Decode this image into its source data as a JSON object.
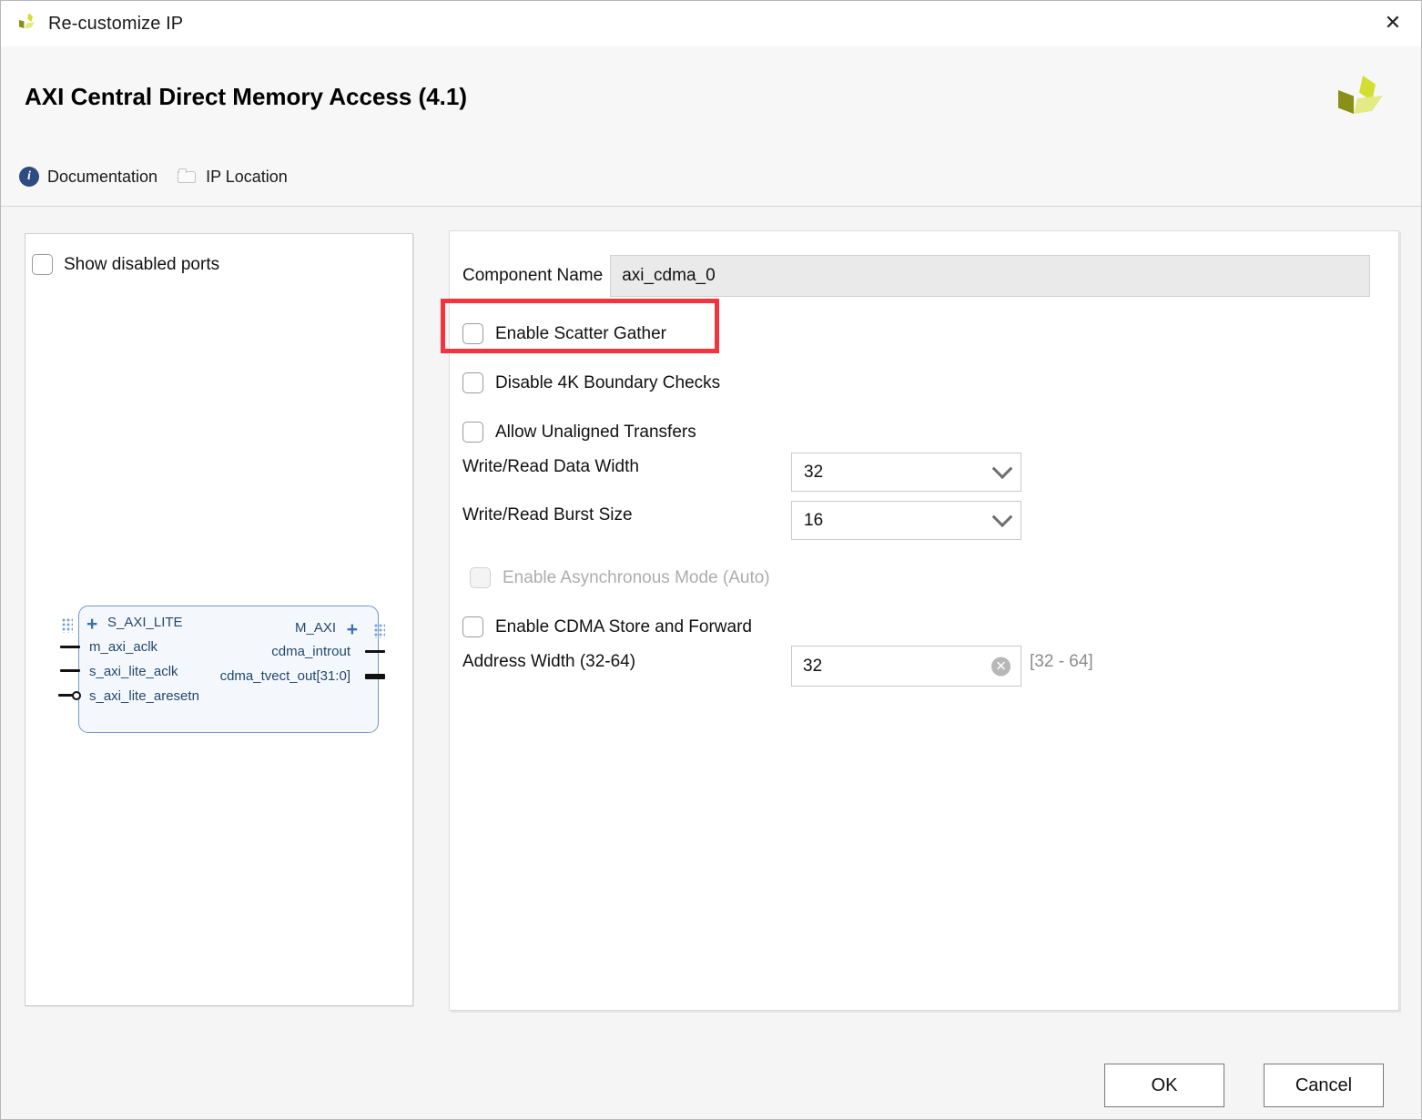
{
  "window": {
    "title": "Re-customize IP",
    "close_label": "✕",
    "logo_name": "xilinx-logo"
  },
  "header": {
    "ip_title": "AXI Central Direct Memory Access (4.1)",
    "links": [
      {
        "label": "Documentation",
        "icon": "info-icon"
      },
      {
        "label": "IP Location",
        "icon": "folder-icon"
      }
    ]
  },
  "ports_panel": {
    "show_disabled_ports_label": "Show disabled ports",
    "show_disabled_ports_checked": false,
    "diagram": {
      "left_ports": [
        {
          "name": "S_AXI_LITE",
          "type": "bus"
        },
        {
          "name": "m_axi_aclk",
          "type": "clock"
        },
        {
          "name": "s_axi_lite_aclk",
          "type": "clock"
        },
        {
          "name": "s_axi_lite_aresetn",
          "type": "reset-active-low"
        }
      ],
      "right_ports": [
        {
          "name": "M_AXI",
          "type": "bus"
        },
        {
          "name": "cdma_introut",
          "type": "signal"
        },
        {
          "name": "cdma_tvect_out[31:0]",
          "type": "vector"
        }
      ]
    }
  },
  "config": {
    "component_name_label": "Component Name",
    "component_name_value": "axi_cdma_0",
    "checkboxes": [
      {
        "label": "Enable Scatter Gather",
        "checked": false,
        "disabled": false,
        "highlighted": true
      },
      {
        "label": "Disable 4K Boundary Checks",
        "checked": false,
        "disabled": false,
        "highlighted": false
      },
      {
        "label": "Allow Unaligned Transfers",
        "checked": false,
        "disabled": false,
        "highlighted": false
      }
    ],
    "data_width_label": "Write/Read Data Width",
    "data_width_value": "32",
    "burst_size_label": "Write/Read Burst Size",
    "burst_size_value": "16",
    "async_mode_label": "Enable Asynchronous Mode (Auto)",
    "async_mode_checked": false,
    "store_forward_label": "Enable CDMA Store and Forward",
    "store_forward_checked": false,
    "address_width_label": "Address Width (32-64)",
    "address_width_value": "32",
    "address_width_range_hint": "[32 - 64]",
    "clear_icon_label": "✕"
  },
  "footer": {
    "ok_label": "OK",
    "cancel_label": "Cancel"
  },
  "colors": {
    "annotation_red": "#f5333f",
    "brand_olive": "#8a8f18",
    "brand_yellow": "#d4dd32",
    "link_blue": "#2d4d80"
  }
}
